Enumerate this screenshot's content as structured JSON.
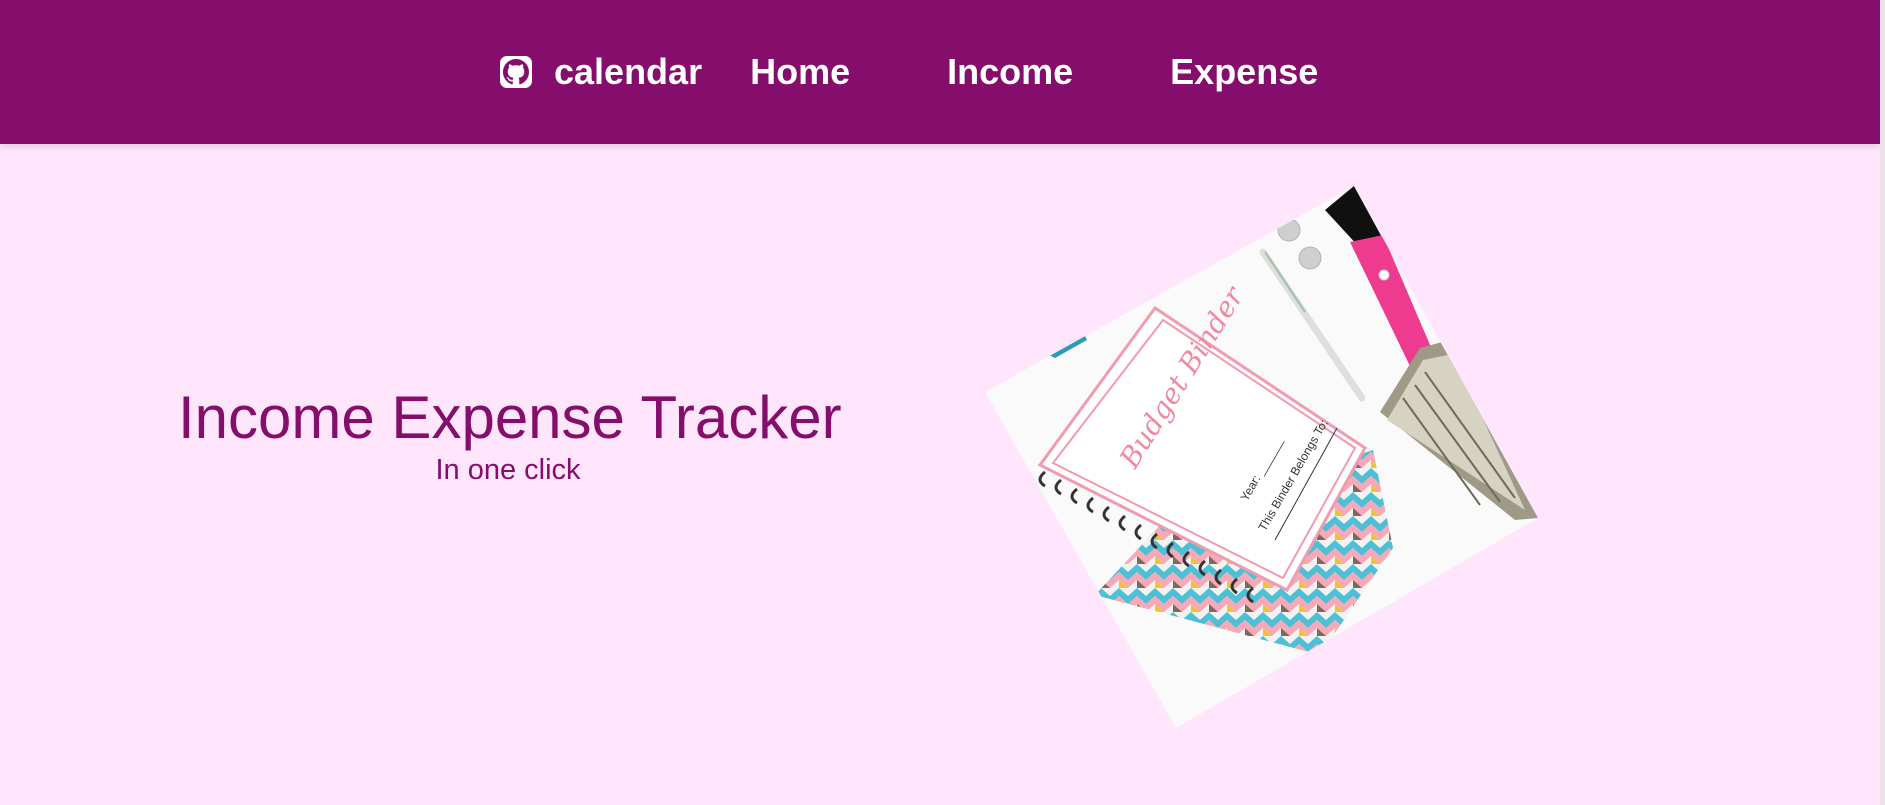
{
  "navbar": {
    "brand_icon": "github-icon",
    "brand_label": "calendar",
    "links": [
      {
        "label": "Home"
      },
      {
        "label": "Income"
      },
      {
        "label": "Expense"
      }
    ],
    "background_color": "#850d6b"
  },
  "hero": {
    "title": "Income Expense Tracker",
    "subtitle": "In one click",
    "text_color": "#850d6b",
    "image": {
      "notebook_title": "Budget Binder",
      "field_year": "Year: ______",
      "field_owner": "This Binder Belongs To:"
    }
  },
  "page": {
    "background_color": "#ffe6fc"
  }
}
